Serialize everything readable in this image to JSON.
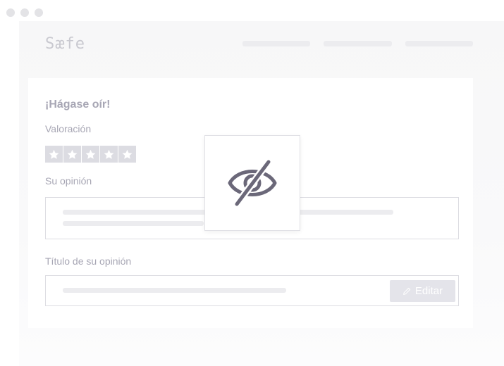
{
  "brand": {
    "logo_text": "Sæfe"
  },
  "review_form": {
    "heading": "¡Hágase oír!",
    "rating_label": "Valoración",
    "rating": {
      "value": 0,
      "max": 5
    },
    "opinion_label": "Su opinión",
    "title_label": "Título de su opinión",
    "edit_button_label": "Editar",
    "edit_icon": "pencil-icon"
  },
  "overlay": {
    "icon": "eye-slash-icon"
  },
  "colors": {
    "text_muted": "#a7a6b4",
    "icon_stroke": "#6b6879",
    "star_bg": "#dcdce2",
    "placeholder": "#ececef"
  }
}
